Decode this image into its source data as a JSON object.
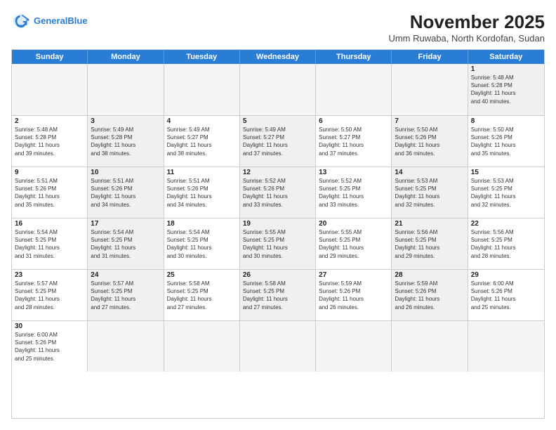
{
  "header": {
    "logo_general": "General",
    "logo_blue": "Blue",
    "title": "November 2025",
    "subtitle": "Umm Ruwaba, North Kordofan, Sudan"
  },
  "days_of_week": [
    "Sunday",
    "Monday",
    "Tuesday",
    "Wednesday",
    "Thursday",
    "Friday",
    "Saturday"
  ],
  "weeks": [
    [
      {
        "day": "",
        "text": "",
        "empty": true
      },
      {
        "day": "",
        "text": "",
        "empty": true
      },
      {
        "day": "",
        "text": "",
        "empty": true
      },
      {
        "day": "",
        "text": "",
        "empty": true
      },
      {
        "day": "",
        "text": "",
        "empty": true
      },
      {
        "day": "",
        "text": "",
        "empty": true
      },
      {
        "day": "1",
        "text": "Sunrise: 5:48 AM\nSunset: 5:28 PM\nDaylight: 11 hours\nand 40 minutes.",
        "empty": false,
        "shaded": true
      }
    ],
    [
      {
        "day": "2",
        "text": "Sunrise: 5:48 AM\nSunset: 5:28 PM\nDaylight: 11 hours\nand 39 minutes.",
        "empty": false,
        "shaded": false
      },
      {
        "day": "3",
        "text": "Sunrise: 5:49 AM\nSunset: 5:28 PM\nDaylight: 11 hours\nand 38 minutes.",
        "empty": false,
        "shaded": true
      },
      {
        "day": "4",
        "text": "Sunrise: 5:49 AM\nSunset: 5:27 PM\nDaylight: 11 hours\nand 38 minutes.",
        "empty": false,
        "shaded": false
      },
      {
        "day": "5",
        "text": "Sunrise: 5:49 AM\nSunset: 5:27 PM\nDaylight: 11 hours\nand 37 minutes.",
        "empty": false,
        "shaded": true
      },
      {
        "day": "6",
        "text": "Sunrise: 5:50 AM\nSunset: 5:27 PM\nDaylight: 11 hours\nand 37 minutes.",
        "empty": false,
        "shaded": false
      },
      {
        "day": "7",
        "text": "Sunrise: 5:50 AM\nSunset: 5:26 PM\nDaylight: 11 hours\nand 36 minutes.",
        "empty": false,
        "shaded": true
      },
      {
        "day": "8",
        "text": "Sunrise: 5:50 AM\nSunset: 5:26 PM\nDaylight: 11 hours\nand 35 minutes.",
        "empty": false,
        "shaded": false
      }
    ],
    [
      {
        "day": "9",
        "text": "Sunrise: 5:51 AM\nSunset: 5:26 PM\nDaylight: 11 hours\nand 35 minutes.",
        "empty": false,
        "shaded": false
      },
      {
        "day": "10",
        "text": "Sunrise: 5:51 AM\nSunset: 5:26 PM\nDaylight: 11 hours\nand 34 minutes.",
        "empty": false,
        "shaded": true
      },
      {
        "day": "11",
        "text": "Sunrise: 5:51 AM\nSunset: 5:26 PM\nDaylight: 11 hours\nand 34 minutes.",
        "empty": false,
        "shaded": false
      },
      {
        "day": "12",
        "text": "Sunrise: 5:52 AM\nSunset: 5:26 PM\nDaylight: 11 hours\nand 33 minutes.",
        "empty": false,
        "shaded": true
      },
      {
        "day": "13",
        "text": "Sunrise: 5:52 AM\nSunset: 5:25 PM\nDaylight: 11 hours\nand 33 minutes.",
        "empty": false,
        "shaded": false
      },
      {
        "day": "14",
        "text": "Sunrise: 5:53 AM\nSunset: 5:25 PM\nDaylight: 11 hours\nand 32 minutes.",
        "empty": false,
        "shaded": true
      },
      {
        "day": "15",
        "text": "Sunrise: 5:53 AM\nSunset: 5:25 PM\nDaylight: 11 hours\nand 32 minutes.",
        "empty": false,
        "shaded": false
      }
    ],
    [
      {
        "day": "16",
        "text": "Sunrise: 5:54 AM\nSunset: 5:25 PM\nDaylight: 11 hours\nand 31 minutes.",
        "empty": false,
        "shaded": false
      },
      {
        "day": "17",
        "text": "Sunrise: 5:54 AM\nSunset: 5:25 PM\nDaylight: 11 hours\nand 31 minutes.",
        "empty": false,
        "shaded": true
      },
      {
        "day": "18",
        "text": "Sunrise: 5:54 AM\nSunset: 5:25 PM\nDaylight: 11 hours\nand 30 minutes.",
        "empty": false,
        "shaded": false
      },
      {
        "day": "19",
        "text": "Sunrise: 5:55 AM\nSunset: 5:25 PM\nDaylight: 11 hours\nand 30 minutes.",
        "empty": false,
        "shaded": true
      },
      {
        "day": "20",
        "text": "Sunrise: 5:55 AM\nSunset: 5:25 PM\nDaylight: 11 hours\nand 29 minutes.",
        "empty": false,
        "shaded": false
      },
      {
        "day": "21",
        "text": "Sunrise: 5:56 AM\nSunset: 5:25 PM\nDaylight: 11 hours\nand 29 minutes.",
        "empty": false,
        "shaded": true
      },
      {
        "day": "22",
        "text": "Sunrise: 5:56 AM\nSunset: 5:25 PM\nDaylight: 11 hours\nand 28 minutes.",
        "empty": false,
        "shaded": false
      }
    ],
    [
      {
        "day": "23",
        "text": "Sunrise: 5:57 AM\nSunset: 5:25 PM\nDaylight: 11 hours\nand 28 minutes.",
        "empty": false,
        "shaded": false
      },
      {
        "day": "24",
        "text": "Sunrise: 5:57 AM\nSunset: 5:25 PM\nDaylight: 11 hours\nand 27 minutes.",
        "empty": false,
        "shaded": true
      },
      {
        "day": "25",
        "text": "Sunrise: 5:58 AM\nSunset: 5:25 PM\nDaylight: 11 hours\nand 27 minutes.",
        "empty": false,
        "shaded": false
      },
      {
        "day": "26",
        "text": "Sunrise: 5:58 AM\nSunset: 5:25 PM\nDaylight: 11 hours\nand 27 minutes.",
        "empty": false,
        "shaded": true
      },
      {
        "day": "27",
        "text": "Sunrise: 5:59 AM\nSunset: 5:26 PM\nDaylight: 11 hours\nand 26 minutes.",
        "empty": false,
        "shaded": false
      },
      {
        "day": "28",
        "text": "Sunrise: 5:59 AM\nSunset: 5:26 PM\nDaylight: 11 hours\nand 26 minutes.",
        "empty": false,
        "shaded": true
      },
      {
        "day": "29",
        "text": "Sunrise: 6:00 AM\nSunset: 5:26 PM\nDaylight: 11 hours\nand 25 minutes.",
        "empty": false,
        "shaded": false
      }
    ],
    [
      {
        "day": "30",
        "text": "Sunrise: 6:00 AM\nSunset: 5:26 PM\nDaylight: 11 hours\nand 25 minutes.",
        "empty": false,
        "shaded": false
      },
      {
        "day": "",
        "text": "",
        "empty": true
      },
      {
        "day": "",
        "text": "",
        "empty": true
      },
      {
        "day": "",
        "text": "",
        "empty": true
      },
      {
        "day": "",
        "text": "",
        "empty": true
      },
      {
        "day": "",
        "text": "",
        "empty": true
      },
      {
        "day": "",
        "text": "",
        "empty": true
      }
    ]
  ]
}
